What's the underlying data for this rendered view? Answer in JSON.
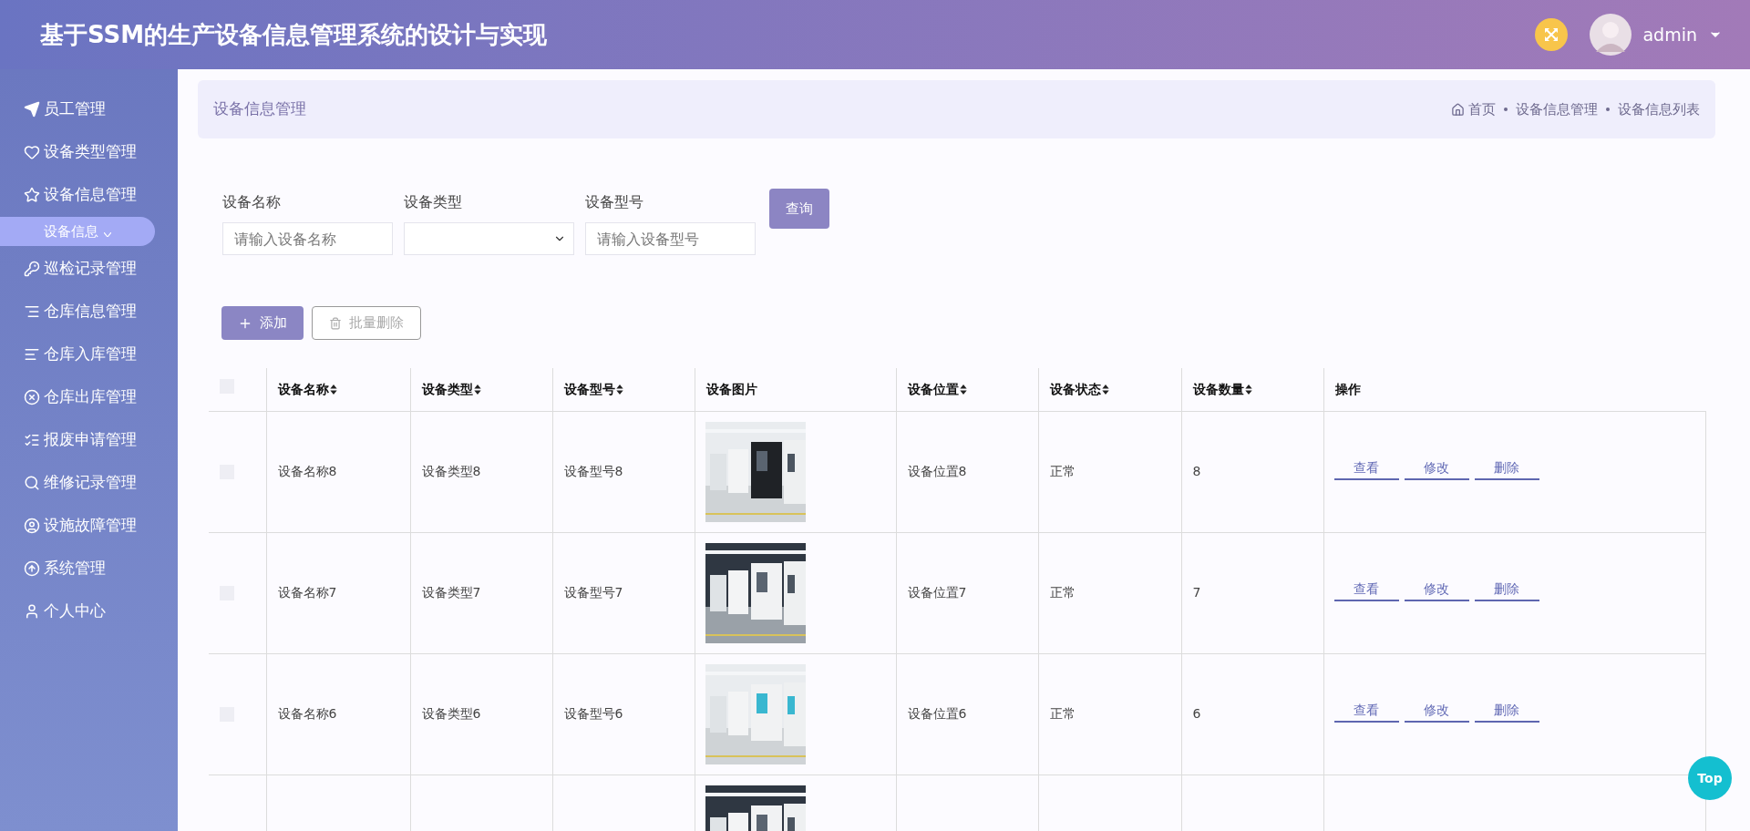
{
  "header": {
    "title": "基于SSM的生产设备信息管理系统的设计与实现",
    "user": "admin"
  },
  "sidebar": {
    "items": [
      {
        "label": "员工管理",
        "selected": false
      },
      {
        "label": "设备类型管理",
        "selected": false
      },
      {
        "label": "设备信息管理",
        "selected": false,
        "expanded": true,
        "children": [
          {
            "label": "设备信息",
            "selected": true
          }
        ]
      },
      {
        "label": "巡检记录管理",
        "selected": false
      },
      {
        "label": "仓库信息管理",
        "selected": false
      },
      {
        "label": "仓库入库管理",
        "selected": false
      },
      {
        "label": "仓库出库管理",
        "selected": false
      },
      {
        "label": "报废申请管理",
        "selected": false
      },
      {
        "label": "维修记录管理",
        "selected": false
      },
      {
        "label": "设施故障管理",
        "selected": false
      },
      {
        "label": "系统管理",
        "selected": false
      },
      {
        "label": "个人中心",
        "selected": false
      }
    ]
  },
  "page_header": {
    "title": "设备信息管理",
    "breadcrumb": [
      "首页",
      "设备信息管理",
      "设备信息列表"
    ]
  },
  "filters": [
    {
      "kind": "input",
      "label": "设备名称",
      "placeholder": "请输入设备名称"
    },
    {
      "kind": "select",
      "label": "设备类型"
    },
    {
      "kind": "input",
      "label": "设备型号",
      "placeholder": "请输入设备型号"
    }
  ],
  "search_button": "查询",
  "actions": [
    {
      "kind": "add",
      "label": "添加",
      "disabled": false
    },
    {
      "kind": "delete",
      "label": "批量删除",
      "disabled": true
    }
  ],
  "table": {
    "select_all": {
      "checked": false
    },
    "columns": [
      {
        "label": "设备名称",
        "sortable": true
      },
      {
        "label": "设备类型",
        "sortable": true
      },
      {
        "label": "设备型号",
        "sortable": true
      },
      {
        "label": "设备图片",
        "sortable": false
      },
      {
        "label": "设备位置",
        "sortable": true
      },
      {
        "label": "设备状态",
        "sortable": true
      },
      {
        "label": "设备数量",
        "sortable": true
      },
      {
        "label": "操作",
        "sortable": false
      }
    ],
    "rows": [
      {
        "checked": false,
        "name": "设备名称8",
        "type": "设备类型8",
        "model": "设备型号8",
        "location": "设备位置8",
        "status": "正常",
        "quantity": "8",
        "actions": [
          "查看",
          "修改",
          "删除"
        ]
      },
      {
        "checked": false,
        "name": "设备名称7",
        "type": "设备类型7",
        "model": "设备型号7",
        "location": "设备位置7",
        "status": "正常",
        "quantity": "7",
        "actions": [
          "查看",
          "修改",
          "删除"
        ]
      },
      {
        "checked": false,
        "name": "设备名称6",
        "type": "设备类型6",
        "model": "设备型号6",
        "location": "设备位置6",
        "status": "正常",
        "quantity": "6",
        "actions": [
          "查看",
          "修改",
          "删除"
        ]
      }
    ]
  },
  "back_to_top": "Top"
}
